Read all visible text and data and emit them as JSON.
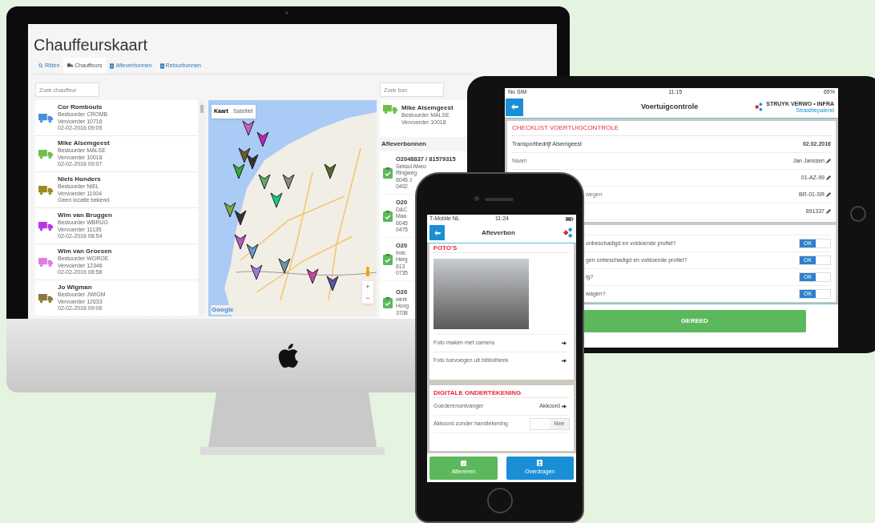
{
  "desktop": {
    "title": "Chauffeurskaart",
    "tabs": [
      {
        "label": "Ritten",
        "selected": false
      },
      {
        "label": "Chauffeurs",
        "selected": true
      },
      {
        "label": "Afleverbonnen",
        "selected": false
      },
      {
        "label": "Retourbonnen",
        "selected": false
      }
    ],
    "driver_search": {
      "placeholder": "Zoek chauffeur"
    },
    "drivers": [
      {
        "name": "Cor Rombouts",
        "driver": "Bestuurder CROMB",
        "carrier": "Vervoerder 10716",
        "last_seen": "02-02-2016 09:05",
        "color": "#4a90d9"
      },
      {
        "name": "Mike Alsemgeest",
        "driver": "Bestuurder MALSE",
        "carrier": "Vervoerder 10018",
        "last_seen": "02-02-2016 09:07",
        "color": "#6cc04a"
      },
      {
        "name": "Niels Honders",
        "driver": "Bestuurder NIEL",
        "carrier": "Vervoerder 11004",
        "last_seen": "Geen locatie bekend",
        "color": "#a08a1e"
      },
      {
        "name": "Wim van Bruggen",
        "driver": "Bestuurder WBRUG",
        "carrier": "Vervoerder 11135",
        "last_seen": "02-02-2016 08:54",
        "color": "#b936e8"
      },
      {
        "name": "Wim van Groesen",
        "driver": "Bestuurder WGROE",
        "carrier": "Vervoerder 12346",
        "last_seen": "02-02-2016 08:58",
        "color": "#e07ae6"
      },
      {
        "name": "Jo Wigman",
        "driver": "Bestuurder JWIGM",
        "carrier": "Vervoerder 12633",
        "last_seen": "02-02-2016 09:06",
        "color": "#8a7a3a"
      }
    ],
    "map": {
      "map_types": [
        {
          "label": "Kaart",
          "selected": true
        },
        {
          "label": "Satelliet",
          "selected": false
        }
      ],
      "zoom_in": "+",
      "zoom_out": "−",
      "logo": "Google"
    },
    "voucher_search": {
      "placeholder": "Zoek bon"
    },
    "selected_driver": {
      "name": "Mike Alsemgeest",
      "driver": "Bestuurder MALSE",
      "carrier": "Vervoerder 10018",
      "color": "#6cc04a"
    },
    "vouchers_heading": "Afleverbonnen",
    "vouchers": [
      {
        "lines": [
          "O2048837 / 81579315",
          "Seksui Alveo",
          "Ringweg",
          "6045 J",
          "0402"
        ]
      },
      {
        "lines": [
          "O20",
          "D&C",
          "Maa",
          "6045",
          "0475"
        ]
      },
      {
        "lines": [
          "O20",
          "Inric",
          "Harg",
          "613",
          "0735"
        ]
      },
      {
        "lines": [
          "O20",
          "werk",
          "Hoog",
          "3708"
        ]
      }
    ]
  },
  "tablet": {
    "status": {
      "carrier": "No SIM",
      "time": "11:15",
      "battery": "65%"
    },
    "title": "Voertuigcontrole",
    "logo": {
      "name": "STRUYK VERWO • INFRA",
      "tagline": "Straatbepalend"
    },
    "checklist_title": "CHECKLIST VOERTUIGCONTROLE",
    "info_rows": [
      {
        "label": "Transportbedrijf Alsemgeest",
        "value": "02.02.2016",
        "editable": false
      },
      {
        "label": "Naam",
        "value": "Jan Janssen",
        "editable": true
      },
      {
        "value": "01-AZ-99",
        "editable": true
      },
      {
        "label": "wegen",
        "value": "BR-01-SR",
        "editable": true
      },
      {
        "value": "891337",
        "editable": true
      }
    ],
    "checks": [
      {
        "label": "onbeschadigd en voldoende profiel?",
        "ok_label": "OK",
        "on": true
      },
      {
        "label": "gen onbeschadigd en voldoende profiel?",
        "ok_label": "OK",
        "on": true
      },
      {
        "label": "ig?",
        "ok_label": "OK",
        "on": true
      },
      {
        "label": "wagen?",
        "ok_label": "OK",
        "on": true
      }
    ],
    "done_button": "GEREED"
  },
  "phone": {
    "status": {
      "carrier": "T-Mobile NL",
      "time": "11:24"
    },
    "title": "Afleverbon",
    "photos_title": "FOTO'S",
    "photo_actions": [
      "Foto maken met camera",
      "Foto toevoegen uit bibliotheek"
    ],
    "signature_title": "DIGITALE ONDERTEKENING",
    "receiver": {
      "label": "Goederenontvanger",
      "value": "Akkoord"
    },
    "no_signature": {
      "label": "Akkoord zonder handtekening",
      "value": "Nee",
      "on": false
    },
    "buttons": [
      {
        "label": "Afleveren",
        "kind": "deliver"
      },
      {
        "label": "Overdragen",
        "kind": "transfer"
      }
    ]
  }
}
